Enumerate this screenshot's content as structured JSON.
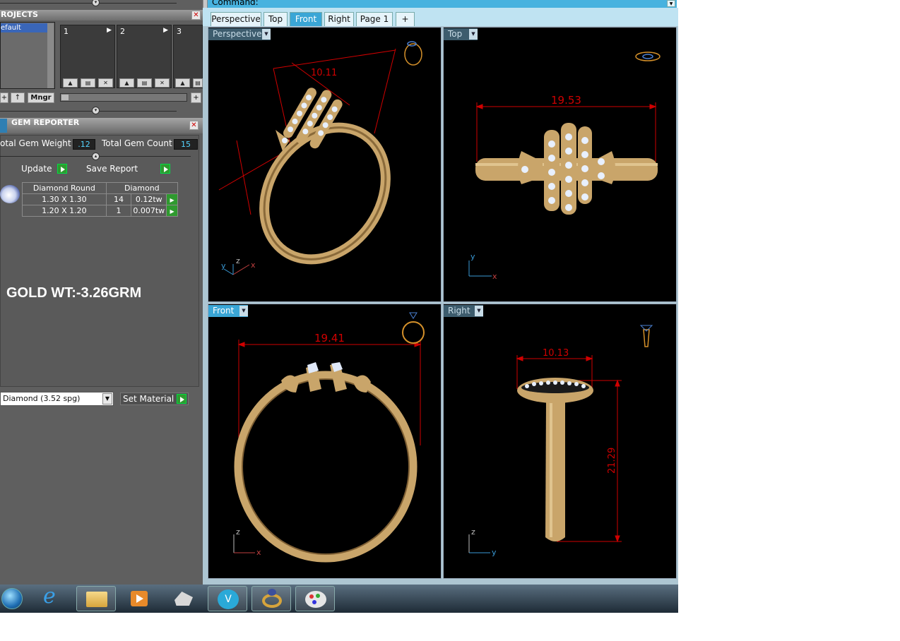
{
  "command": {
    "label": "Command:"
  },
  "projects": {
    "title": "ROJECTS",
    "list_item": "efault",
    "slots": [
      "1",
      "2",
      "3"
    ],
    "buttons": {
      "add": "+",
      "up": "↑",
      "manager": "Mngr",
      "plus": "+"
    }
  },
  "gem_reporter": {
    "title": "GEM REPORTER",
    "total_weight_label": "otal Gem Weight",
    "total_weight_value": ".12",
    "total_count_label": "Total Gem Count",
    "total_count_value": "15",
    "update_label": "Update",
    "save_label": "Save Report",
    "table": {
      "headers": [
        "Diamond Round",
        "Diamond"
      ],
      "rows": [
        {
          "size": "1.30 X 1.30",
          "count": "14",
          "weight": "0.12tw"
        },
        {
          "size": "1.20 X 1.20",
          "count": "1",
          "weight": "0.007tw"
        }
      ]
    },
    "note": "GOLD WT:-3.26GRM",
    "material_select": "Diamond    (3.52 spg)",
    "set_material_label": "Set Material"
  },
  "view_tabs": [
    {
      "label": "Perspective",
      "active": false
    },
    {
      "label": "Top",
      "active": false
    },
    {
      "label": "Front",
      "active": true
    },
    {
      "label": "Right",
      "active": false
    },
    {
      "label": "Page 1",
      "active": false
    }
  ],
  "viewports": {
    "perspective": {
      "label": "Perspective",
      "dim": "10.11",
      "axes": [
        "y",
        "z",
        "x"
      ]
    },
    "top": {
      "label": "Top",
      "dim": "19.53",
      "axes": [
        "y",
        "x"
      ]
    },
    "front": {
      "label": "Front",
      "dim": "19.41",
      "axes": [
        "z",
        "x"
      ]
    },
    "right": {
      "label": "Right",
      "dim_w": "10.13",
      "dim_h": "21.29",
      "axes": [
        "z",
        "y"
      ]
    }
  },
  "colors": {
    "accent": "#3aa6d6",
    "dimension": "#d00000",
    "gold": "#c9a56a",
    "panel": "#5f5f5f"
  },
  "taskbar": {
    "icons": [
      "start-orb-icon",
      "internet-explorer-icon",
      "file-explorer-icon",
      "media-player-icon",
      "rhino-icon",
      "vray-icon",
      "ring-app-icon",
      "paint-icon"
    ]
  }
}
